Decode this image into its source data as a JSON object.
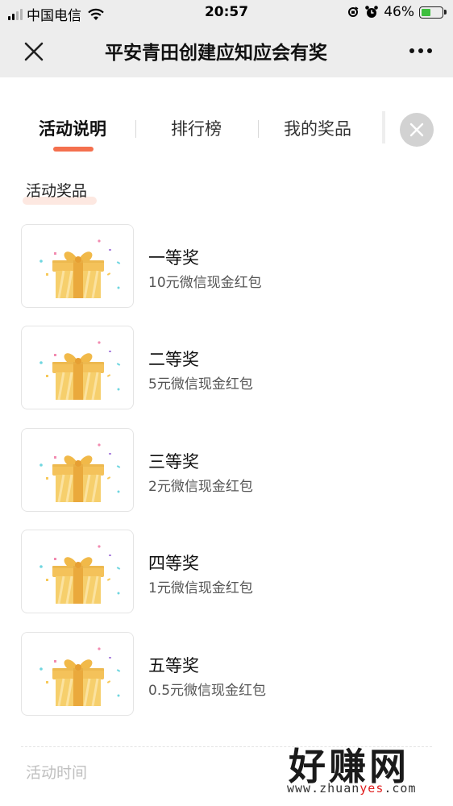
{
  "status_bar": {
    "carrier": "中国电信",
    "time": "20:57",
    "battery": "46%",
    "battery_level": 0.46
  },
  "nav": {
    "title": "平安青田创建应知应会有奖"
  },
  "tabs": [
    {
      "label": "活动说明",
      "active": true
    },
    {
      "label": "排行榜",
      "active": false
    },
    {
      "label": "我的奖品",
      "active": false
    }
  ],
  "section_prizes": "活动奖品",
  "prizes": [
    {
      "name": "一等奖",
      "desc": "10元微信现金红包"
    },
    {
      "name": "二等奖",
      "desc": "5元微信现金红包"
    },
    {
      "name": "三等奖",
      "desc": "2元微信现金红包"
    },
    {
      "name": "四等奖",
      "desc": "1元微信现金红包"
    },
    {
      "name": "五等奖",
      "desc": "0.5元微信现金红包"
    }
  ],
  "section_time": "活动时间",
  "watermark": {
    "brand": "好赚网",
    "url_prefix": "www.zhuan",
    "url_highlight": "yes",
    "url_suffix": ".com"
  },
  "colors": {
    "accent": "#f4704e",
    "gift": "#f2c055"
  }
}
